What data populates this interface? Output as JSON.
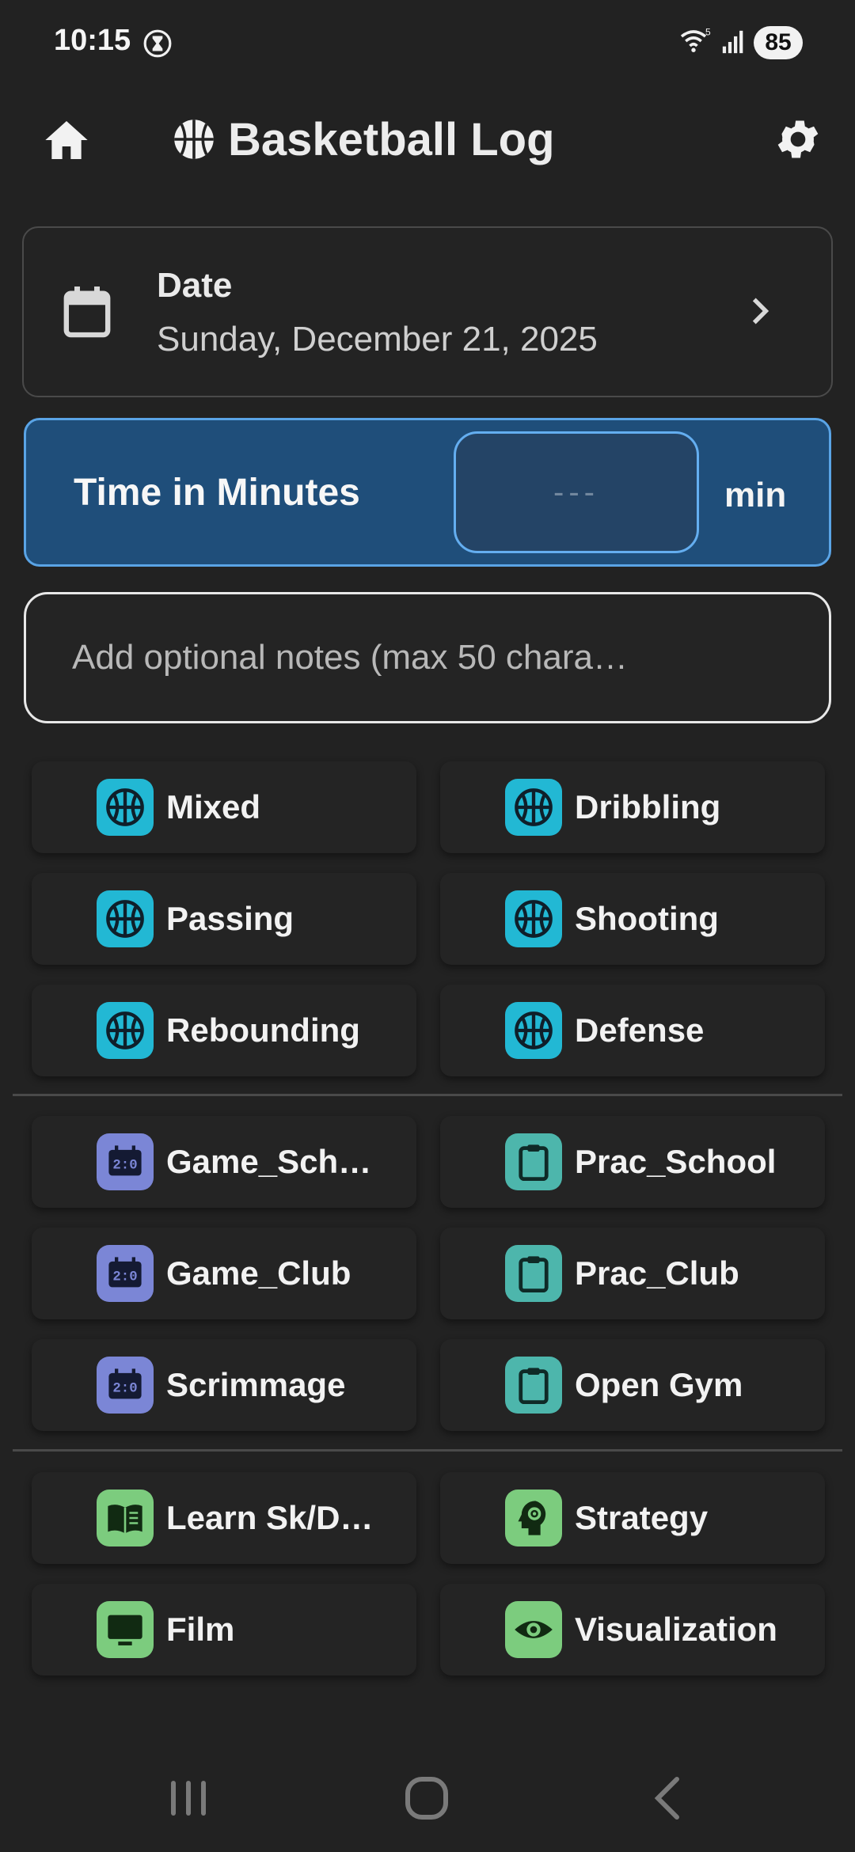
{
  "status_bar": {
    "time": "10:15",
    "battery": "85"
  },
  "app_bar": {
    "title": "Basketball Log"
  },
  "date_card": {
    "label": "Date",
    "value": "Sunday, December 21, 2025"
  },
  "time_card": {
    "label": "Time in Minutes",
    "input_placeholder": "---",
    "unit": "min"
  },
  "notes": {
    "placeholder": "Add optional notes (max 50 chara…"
  },
  "colors": {
    "skill_badge": "#22b8d4",
    "game_badge": "#7b86d6",
    "practice_badge": "#4db6ac",
    "mental_badge": "#7ccc7e",
    "time_card_bg": "#1f4e7a"
  },
  "skills": [
    {
      "label": "Mixed",
      "icon": "basketball-icon"
    },
    {
      "label": "Dribbling",
      "icon": "basketball-icon"
    },
    {
      "label": "Passing",
      "icon": "basketball-icon"
    },
    {
      "label": "Shooting",
      "icon": "basketball-icon"
    },
    {
      "label": "Rebounding",
      "icon": "basketball-icon"
    },
    {
      "label": "Defense",
      "icon": "basketball-icon"
    }
  ],
  "sessions": [
    {
      "label": "Game_Sch…",
      "icon": "scoreboard-icon"
    },
    {
      "label": "Prac_School",
      "icon": "clipboard-icon"
    },
    {
      "label": "Game_Club",
      "icon": "scoreboard-icon"
    },
    {
      "label": "Prac_Club",
      "icon": "clipboard-icon"
    },
    {
      "label": "Scrimmage",
      "icon": "scoreboard-icon"
    },
    {
      "label": "Open Gym",
      "icon": "clipboard-icon"
    }
  ],
  "mental": [
    {
      "label": "Learn Sk/D…",
      "icon": "book-icon"
    },
    {
      "label": "Strategy",
      "icon": "brain-gear-icon"
    },
    {
      "label": "Film",
      "icon": "monitor-icon"
    },
    {
      "label": "Visualization",
      "icon": "eye-icon"
    }
  ]
}
